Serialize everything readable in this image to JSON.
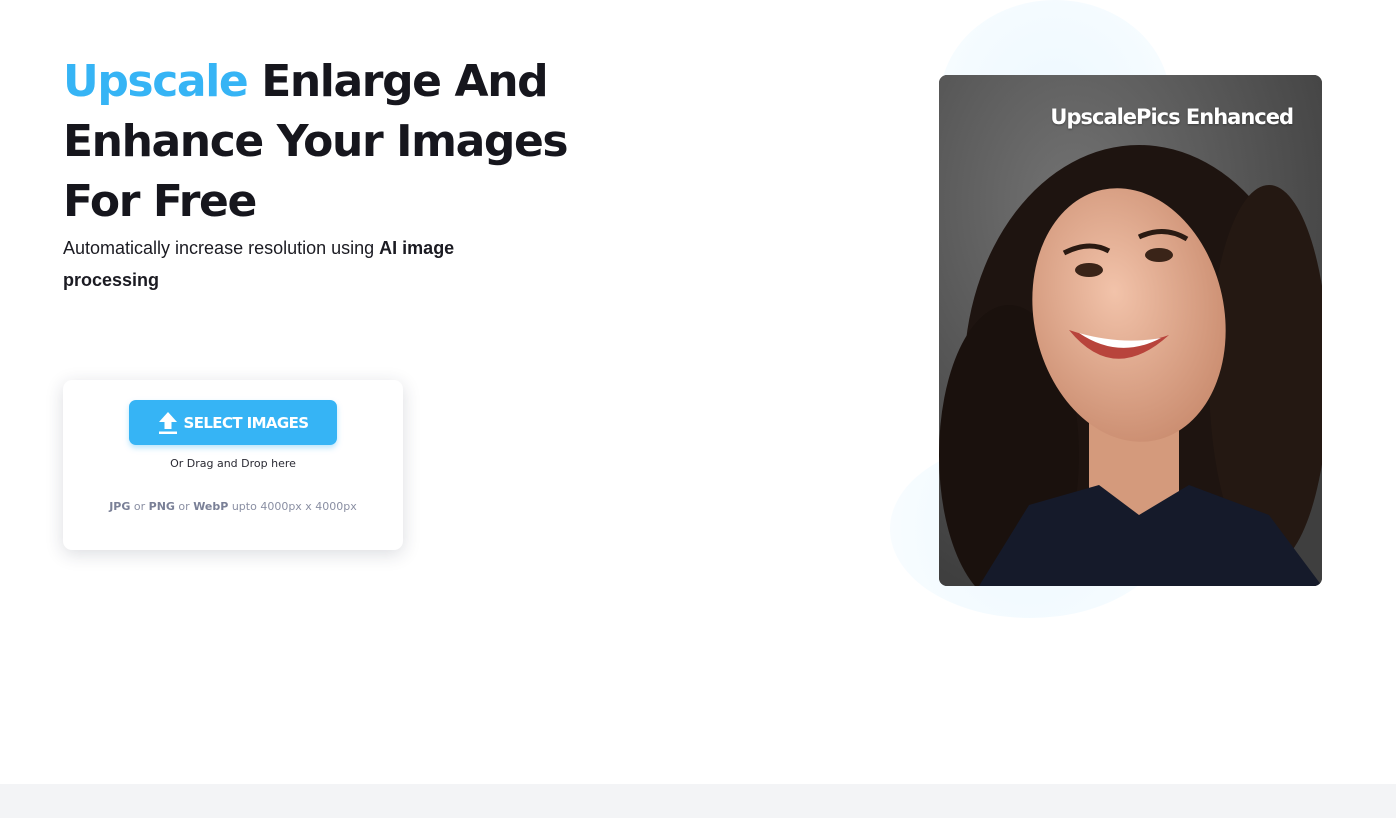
{
  "hero": {
    "title_accent": "Upscale",
    "title_rest": " Enlarge And Enhance Your Images For Free",
    "subtitle_text": "Automatically increase resolution using ",
    "subtitle_bold": "AI image processing"
  },
  "upload": {
    "button_label": "SELECT IMAGES",
    "button_icon": "upload-icon",
    "drag_text": "Or Drag and Drop here",
    "formats": {
      "jpg": "JPG",
      "or_1": " or ",
      "png": "PNG",
      "or_2": " or ",
      "webp": "WebP",
      "limit": " upto 4000px x 4000px"
    }
  },
  "preview": {
    "caption": "UpscalePics Enhanced"
  },
  "colors": {
    "accent": "#36b4f5",
    "text": "#16161d",
    "footer": "#f3f4f6"
  }
}
